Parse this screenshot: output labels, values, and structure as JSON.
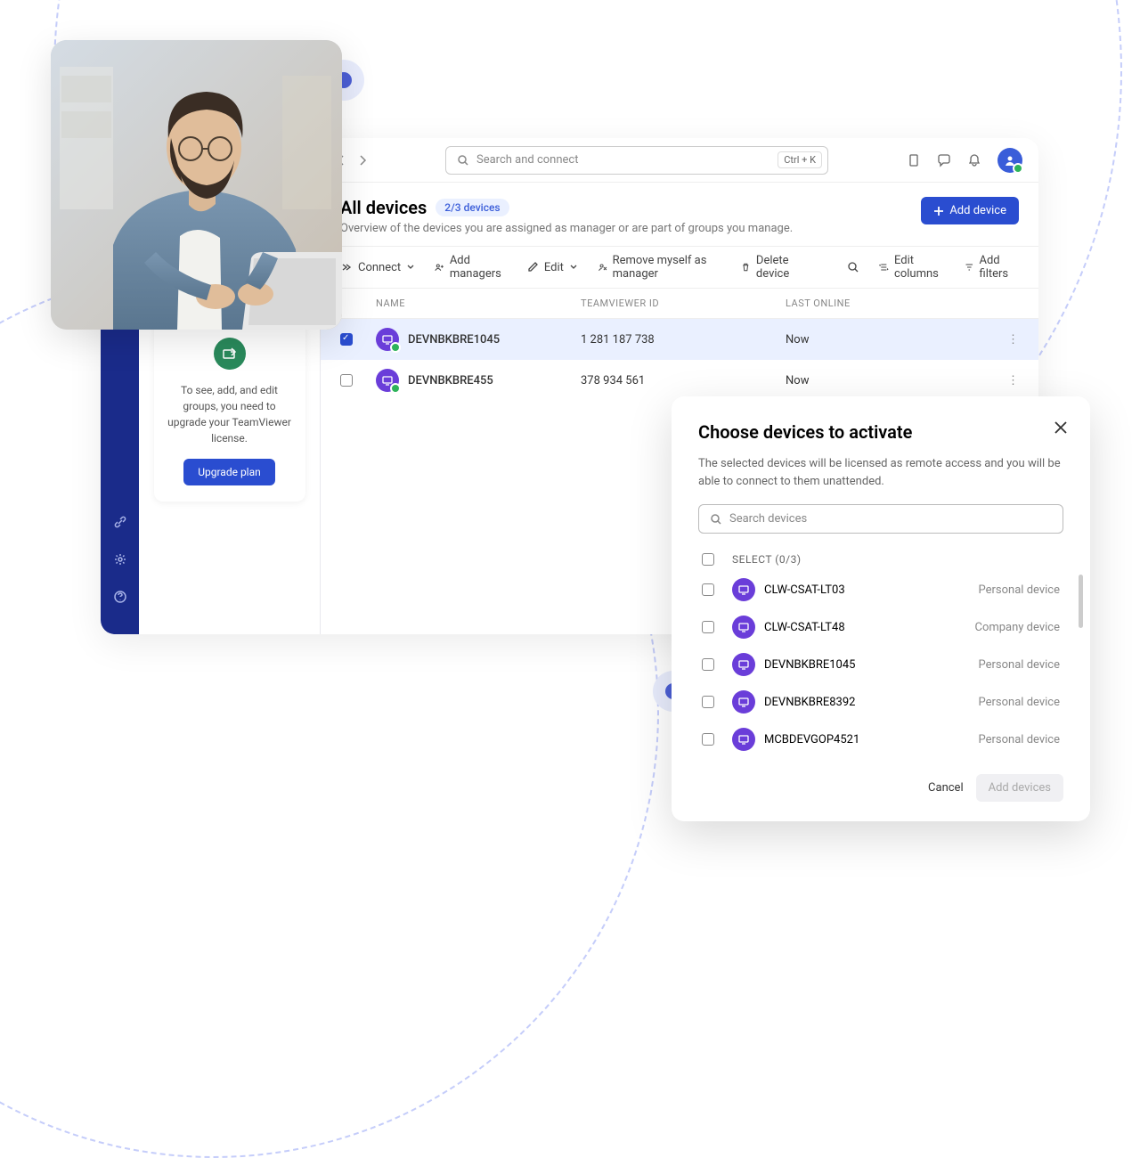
{
  "header": {
    "title": "All devices",
    "badge": "2/3 devices",
    "subtitle": "Overview of the devices you are assigned as manager or are part of groups you manage.",
    "add_button": "Add device"
  },
  "search": {
    "placeholder": "Search and connect",
    "shortcut": "Ctrl + K"
  },
  "toolbar": {
    "connect": "Connect",
    "add_managers": "Add managers",
    "edit": "Edit",
    "remove_self": "Remove myself as manager",
    "delete": "Delete device",
    "edit_columns": "Edit columns",
    "add_filters": "Add filters"
  },
  "columns": {
    "name": "NAME",
    "id": "TEAMVIEWER ID",
    "online": "LAST ONLINE"
  },
  "devices": [
    {
      "name": "DEVNBKBRE1045",
      "id": "1 281 187 738",
      "online": "Now",
      "selected": true
    },
    {
      "name": "DEVNBKBRE455",
      "id": "378 934 561",
      "online": "Now",
      "selected": false
    }
  ],
  "upgrade": {
    "text": "To see, add, and edit groups, you need to upgrade your TeamViewer license.",
    "button": "Upgrade plan"
  },
  "modal": {
    "title": "Choose devices to activate",
    "desc": "The selected devices will be licensed as remote access and you will be able to connect to them unattended.",
    "search_placeholder": "Search devices",
    "select_label": "SELECT (0/3)",
    "cancel": "Cancel",
    "add": "Add devices",
    "items": [
      {
        "name": "CLW-CSAT-LT03",
        "type": "Personal device"
      },
      {
        "name": "CLW-CSAT-LT48",
        "type": "Company device"
      },
      {
        "name": "DEVNBKBRE1045",
        "type": "Personal device"
      },
      {
        "name": "DEVNBKBRE8392",
        "type": "Personal device"
      },
      {
        "name": "MCBDEVGOP4521",
        "type": "Personal device"
      }
    ]
  }
}
